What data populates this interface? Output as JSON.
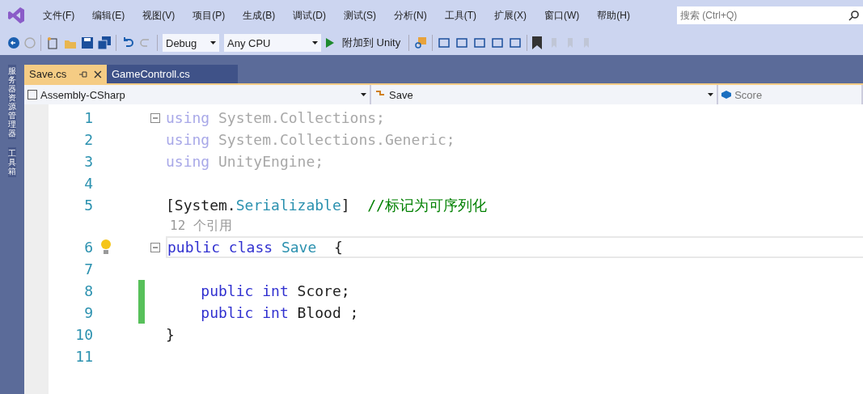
{
  "menu": [
    "文件(F)",
    "编辑(E)",
    "视图(V)",
    "项目(P)",
    "生成(B)",
    "调试(D)",
    "测试(S)",
    "分析(N)",
    "工具(T)",
    "扩展(X)",
    "窗口(W)",
    "帮助(H)"
  ],
  "search": {
    "placeholder": "搜索 (Ctrl+Q)"
  },
  "toolbar": {
    "configuration": "Debug",
    "platform": "Any CPU",
    "run": "附加到 Unity"
  },
  "side_panels": [
    "服务器资源管理器",
    "工具箱"
  ],
  "tabs": [
    {
      "label": "Save.cs",
      "selected": true
    },
    {
      "label": "GameControll.cs",
      "selected": false
    }
  ],
  "navigation": {
    "project": "Assembly-CSharp",
    "type": "Save",
    "member": "Score"
  },
  "code": [
    {
      "kind": "line",
      "number": "1",
      "fold": true,
      "changed": false,
      "tokens": [
        {
          "text": "using",
          "kind": "keyword-faded"
        },
        {
          "text": " System.Collections;",
          "kind": "faded"
        }
      ]
    },
    {
      "kind": "line",
      "number": "2",
      "fold": false,
      "changed": false,
      "tokens": [
        {
          "text": "using",
          "kind": "keyword-faded"
        },
        {
          "text": " System.Collections.Generic;",
          "kind": "faded"
        }
      ]
    },
    {
      "kind": "line",
      "number": "3",
      "fold": false,
      "changed": false,
      "tokens": [
        {
          "text": "using",
          "kind": "keyword-faded"
        },
        {
          "text": " UnityEngine;",
          "kind": "faded"
        }
      ]
    },
    {
      "kind": "line",
      "number": "4",
      "fold": false,
      "changed": false
    },
    {
      "kind": "line",
      "number": "5",
      "fold": false,
      "changed": false,
      "tokens": [
        {
          "text": "[System.",
          "kind": "plain"
        },
        {
          "text": "Serializable",
          "kind": "type"
        },
        {
          "text": "]  ",
          "kind": "plain"
        },
        {
          "text": "//标记为可序列化",
          "kind": "comment"
        }
      ]
    },
    {
      "kind": "codelens",
      "text": "12 个引用"
    },
    {
      "kind": "line",
      "number": "6",
      "fold": true,
      "changed": false,
      "bulb": true,
      "current": true,
      "tokens": [
        {
          "text": "public",
          "kind": "keyword"
        },
        {
          "text": " class",
          "kind": "keyword"
        },
        {
          "text": " Save",
          "kind": "type"
        },
        {
          "text": "  {",
          "kind": "plain"
        }
      ]
    },
    {
      "kind": "line",
      "number": "7",
      "fold": false,
      "changed": false
    },
    {
      "kind": "line",
      "number": "8",
      "fold": false,
      "changed": true,
      "tokens": [
        {
          "text": "    public",
          "kind": "keyword"
        },
        {
          "text": " int",
          "kind": "keyword"
        },
        {
          "text": " Score;",
          "kind": "plain"
        }
      ]
    },
    {
      "kind": "line",
      "number": "9",
      "fold": false,
      "changed": true,
      "tokens": [
        {
          "text": "    public",
          "kind": "keyword"
        },
        {
          "text": " int",
          "kind": "keyword"
        },
        {
          "text": " Blood ;",
          "kind": "plain"
        }
      ]
    },
    {
      "kind": "line",
      "number": "10",
      "fold": false,
      "changed": false,
      "tokens": [
        {
          "text": "}",
          "kind": "plain"
        }
      ]
    },
    {
      "kind": "line",
      "number": "11",
      "fold": false,
      "changed": false
    }
  ]
}
